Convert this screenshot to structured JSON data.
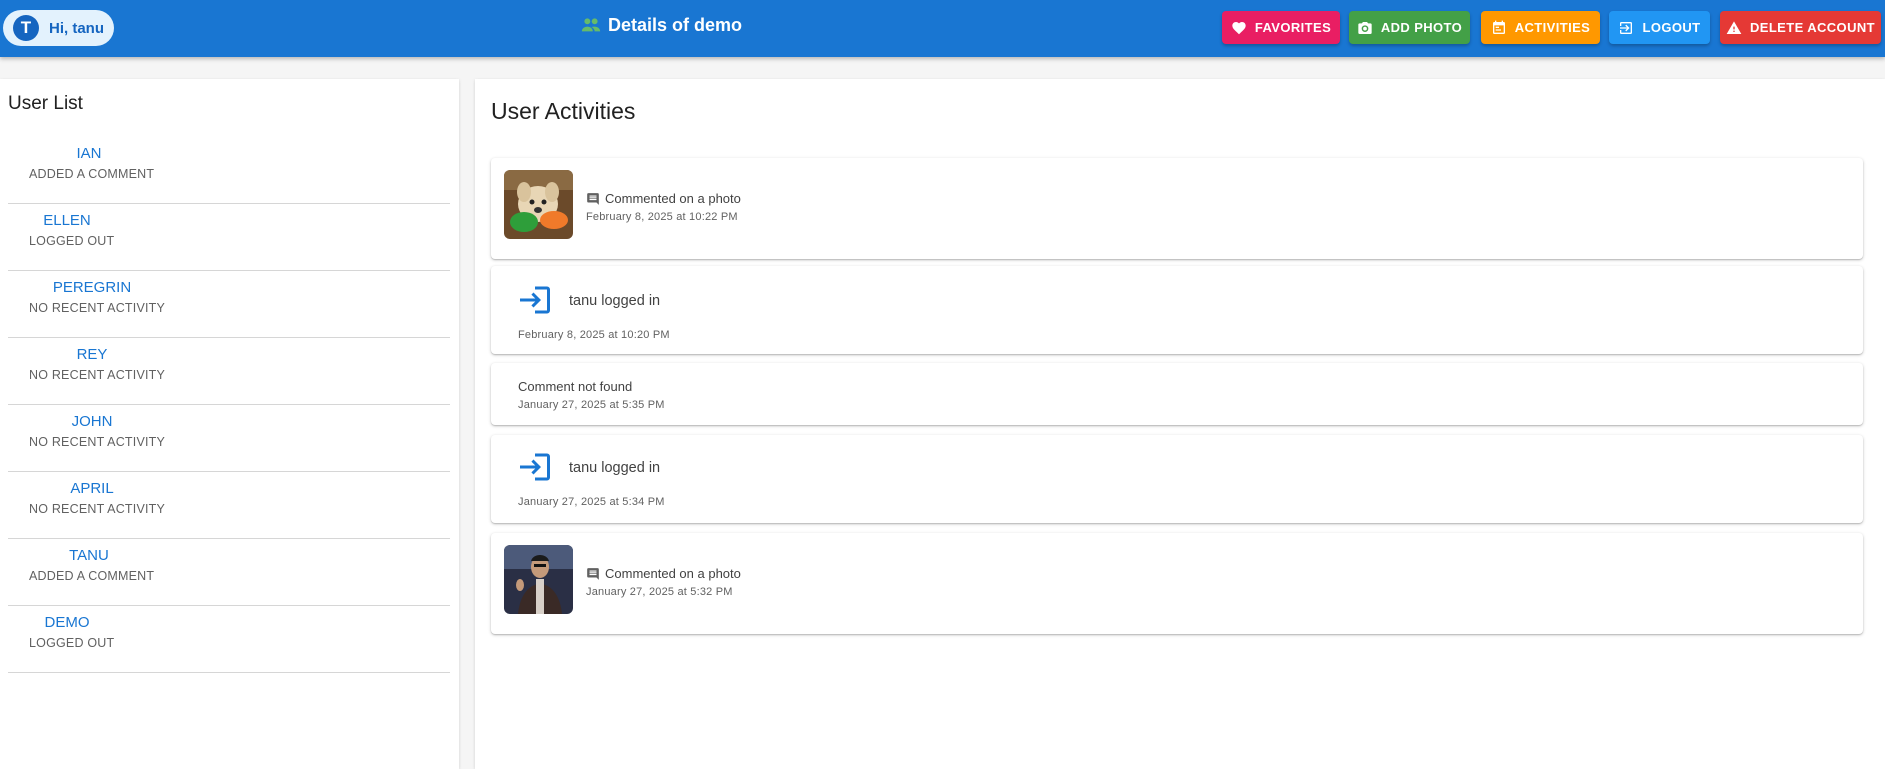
{
  "header": {
    "avatar_letter": "T",
    "greeting": "Hi, tanu",
    "title": "Details of demo",
    "buttons": {
      "favorites": "FAVORITES",
      "add_photo": "ADD PHOTO",
      "activities": "ACTIVITIES",
      "logout": "LOGOUT",
      "delete_account": "DELETE ACCOUNT"
    }
  },
  "sidebar": {
    "title": "User List",
    "users": [
      {
        "name": "IAN",
        "status": "ADDED A COMMENT"
      },
      {
        "name": "ELLEN",
        "status": "LOGGED OUT"
      },
      {
        "name": "PEREGRIN",
        "status": "NO RECENT ACTIVITY"
      },
      {
        "name": "REY",
        "status": "NO RECENT ACTIVITY"
      },
      {
        "name": "JOHN",
        "status": "NO RECENT ACTIVITY"
      },
      {
        "name": "APRIL",
        "status": "NO RECENT ACTIVITY"
      },
      {
        "name": "TANU",
        "status": "ADDED A COMMENT"
      },
      {
        "name": "DEMO",
        "status": "LOGGED OUT"
      }
    ]
  },
  "main": {
    "title": "User Activities",
    "activities": [
      {
        "type": "comment",
        "text": "Commented on a photo",
        "date": "February 8, 2025 at 10:22 PM"
      },
      {
        "type": "login",
        "text": "tanu logged in",
        "date": "February 8, 2025 at 10:20 PM"
      },
      {
        "type": "plain",
        "text": "Comment not found",
        "date": "January 27, 2025 at 5:35 PM"
      },
      {
        "type": "login",
        "text": "tanu logged in",
        "date": "January 27, 2025 at 5:34 PM"
      },
      {
        "type": "comment",
        "text": "Commented on a photo",
        "date": "January 27, 2025 at 5:32 PM"
      }
    ]
  },
  "colors": {
    "appbar": "#1976d2",
    "favorites": "#e91e63",
    "add_photo": "#43a047",
    "activities": "#ff9800",
    "logout": "#2196f3",
    "delete": "#e53935",
    "link": "#1976d2"
  }
}
